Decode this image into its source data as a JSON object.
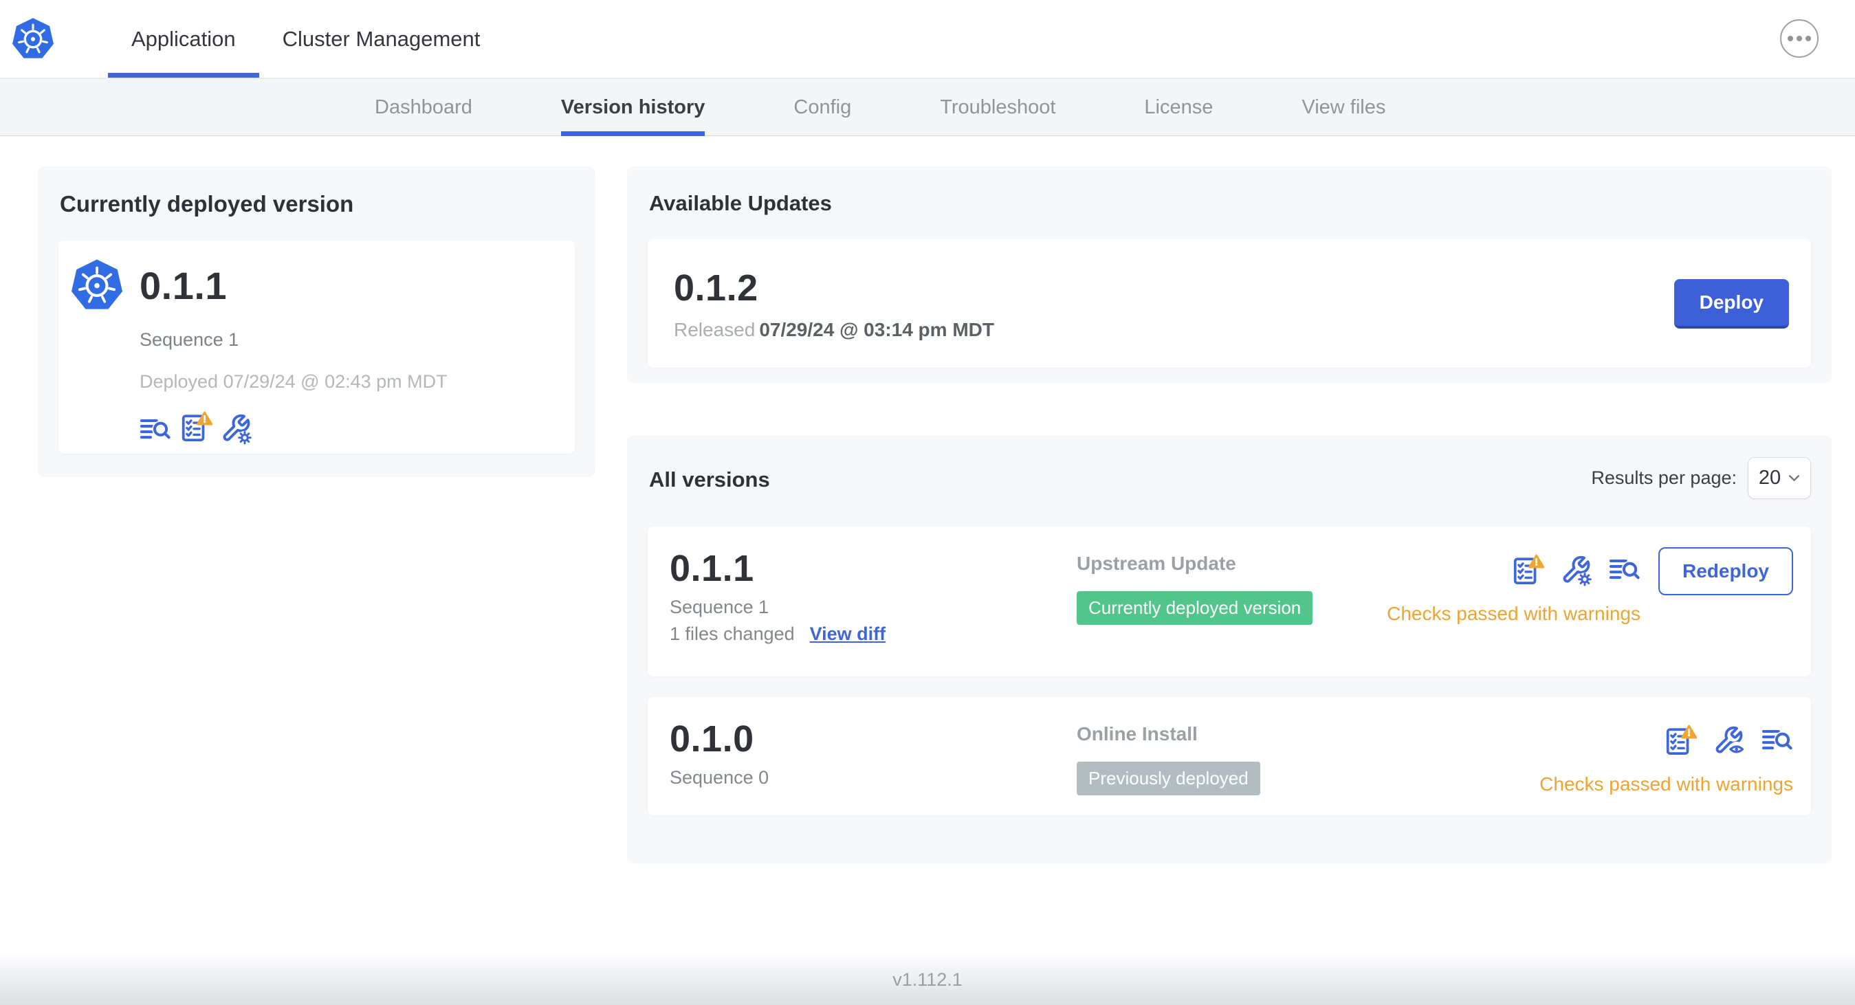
{
  "topnav": {
    "tabs": [
      {
        "label": "Application"
      },
      {
        "label": "Cluster Management"
      }
    ],
    "menu_icon": "ellipsis-icon"
  },
  "subnav": {
    "tabs": [
      "Dashboard",
      "Version history",
      "Config",
      "Troubleshoot",
      "License",
      "View files"
    ],
    "active_tab": "Version history"
  },
  "current_version": {
    "title": "Currently deployed version",
    "version": "0.1.1",
    "sequence": "Sequence 1",
    "deployed": "Deployed 07/29/24 @ 02:43 pm MDT",
    "icons": [
      "release-notes-icon",
      "preflight-checks-warning-icon",
      "config-wrench-gear-icon"
    ]
  },
  "available_updates": {
    "title": "Available Updates",
    "version": "0.1.2",
    "released_label": "Released",
    "released_date": "07/29/24 @ 03:14 pm MDT",
    "deploy_label": "Deploy"
  },
  "all_versions": {
    "title": "All versions",
    "results_per_page_label": "Results per page:",
    "results_per_page_value": "20",
    "rows": [
      {
        "version": "0.1.1",
        "sequence": "Sequence 1",
        "files_changed": "1 files changed",
        "view_diff": "View diff",
        "source": "Upstream Update",
        "badge": {
          "label": "Currently deployed version",
          "color": "#52c58b"
        },
        "status": "Checks passed with warnings",
        "action": "Redeploy",
        "icons": [
          "preflight-checks-warning-icon",
          "config-wrench-gear-icon",
          "release-notes-icon"
        ]
      },
      {
        "version": "0.1.0",
        "sequence": "Sequence 0",
        "source": "Online Install",
        "badge": {
          "label": "Previously deployed",
          "color": "#b2bcc1"
        },
        "status": "Checks passed with warnings",
        "icons": [
          "preflight-checks-warning-icon",
          "config-wrench-eye-icon",
          "release-notes-icon"
        ]
      }
    ]
  },
  "footer": {
    "app_version": "v1.112.1"
  },
  "colors": {
    "accent": "#3e66db",
    "kubernetes_blue": "#326ce5",
    "deploy_button": "#3d60d8",
    "warning_text": "#eca434",
    "badge_green": "#52c58b",
    "badge_gray": "#b2bcc1"
  }
}
